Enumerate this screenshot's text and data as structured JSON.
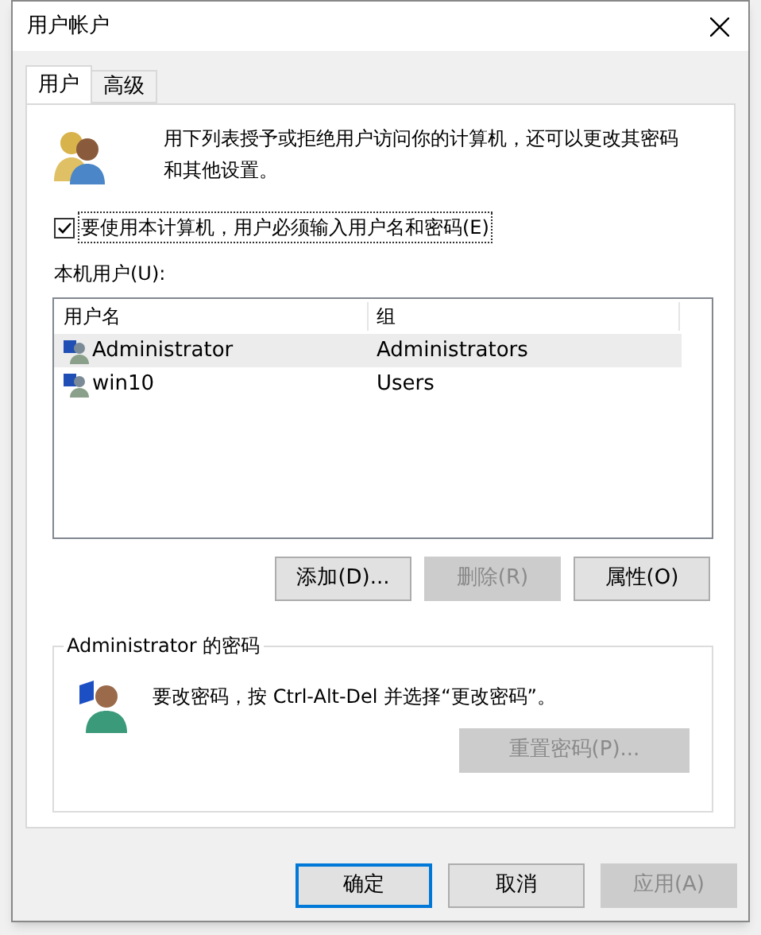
{
  "window": {
    "title": "用户帐户"
  },
  "tabs": [
    {
      "label": "用户",
      "selected": true
    },
    {
      "label": "高级",
      "selected": false
    }
  ],
  "intro": "用下列表授予或拒绝用户访问你的计算机，还可以更改其密码和其他设置。",
  "require_password": {
    "label": "要使用本计算机，用户必须输入用户名和密码(E)",
    "checked": true
  },
  "users_label": "本机用户(U):",
  "table": {
    "columns": [
      "用户名",
      "组"
    ],
    "rows": [
      {
        "name": "Administrator",
        "group": "Administrators",
        "selected": true
      },
      {
        "name": "win10",
        "group": "Users",
        "selected": false
      }
    ]
  },
  "user_buttons": [
    {
      "label": "添加(D)...",
      "disabled": false
    },
    {
      "label": "删除(R)",
      "disabled": true
    },
    {
      "label": "属性(O)",
      "disabled": false
    }
  ],
  "password_group": {
    "title": "Administrator 的密码",
    "text": "要改密码，按 Ctrl-Alt-Del 并选择“更改密码”。",
    "button": {
      "label": "重置密码(P)...",
      "disabled": true
    }
  },
  "footer_buttons": [
    {
      "label": "确定",
      "default": true,
      "disabled": false
    },
    {
      "label": "取消",
      "default": false,
      "disabled": false
    },
    {
      "label": "应用(A)",
      "default": false,
      "disabled": true
    }
  ]
}
